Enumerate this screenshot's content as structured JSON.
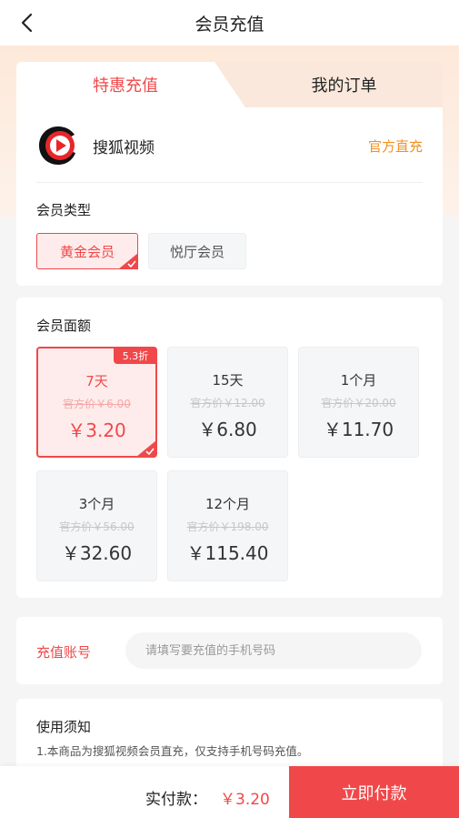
{
  "header": {
    "title": "会员充值",
    "back_icon": "chevron-left-icon"
  },
  "tabs": {
    "active": "特惠充值",
    "other": "我的订单"
  },
  "brand": {
    "name": "搜狐视频",
    "tag": "官方直充"
  },
  "member_type": {
    "title": "会员类型",
    "options": [
      {
        "label": "黄金会员",
        "selected": true
      },
      {
        "label": "悦厅会员",
        "selected": false
      }
    ]
  },
  "amount": {
    "title": "会员面额",
    "options": [
      {
        "name": "7天",
        "orig": "官方价￥6.00",
        "price": "￥3.20",
        "badge": "5.3折",
        "selected": true
      },
      {
        "name": "15天",
        "orig": "官方价￥12.00",
        "price": "￥6.80",
        "selected": false
      },
      {
        "name": "1个月",
        "orig": "官方价￥20.00",
        "price": "￥11.70",
        "selected": false
      },
      {
        "name": "3个月",
        "orig": "官方价￥56.00",
        "price": "￥32.60",
        "selected": false
      },
      {
        "name": "12个月",
        "orig": "官方价￥198.00",
        "price": "￥115.40",
        "selected": false
      }
    ]
  },
  "account": {
    "label": "充值账号",
    "placeholder": "请填写要充值的手机号码"
  },
  "notice": {
    "title": "使用须知",
    "line1": "1.本商品为搜狐视频会员直充，仅支持手机号码充值。"
  },
  "footer": {
    "pay_label": "实付款：",
    "pay_value": "￥3.20",
    "pay_button": "立即付款"
  },
  "colors": {
    "accent": "#f0484a",
    "orange": "#f29023",
    "peach": "#fde9da"
  }
}
